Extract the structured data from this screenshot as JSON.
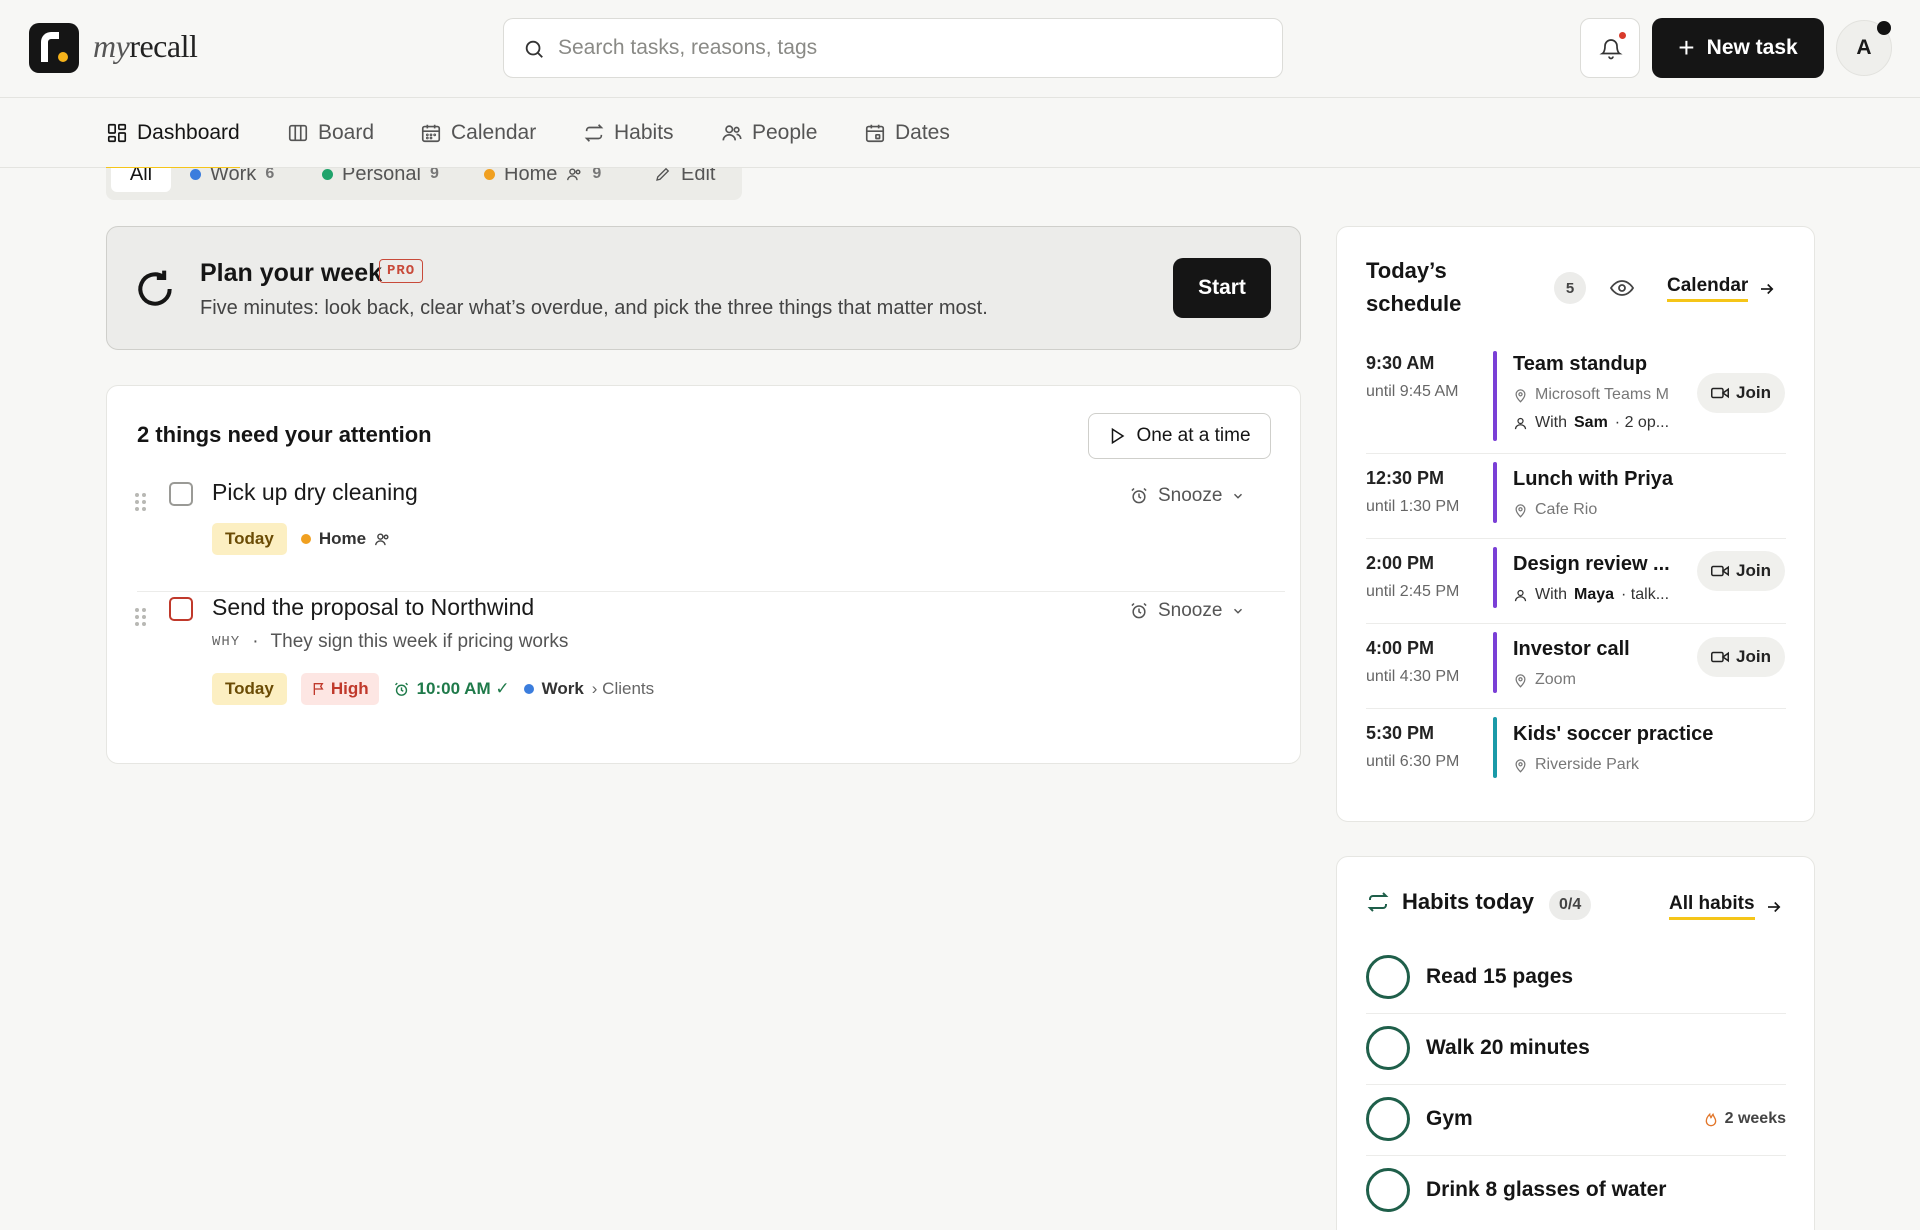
{
  "app": {
    "brand_prefix": "my",
    "brand_suffix": "recall"
  },
  "search": {
    "placeholder": "Search tasks, reasons, tags",
    "value": ""
  },
  "header": {
    "new_task_label": "New task",
    "avatar_initial": "A"
  },
  "nav": [
    {
      "label": "Dashboard",
      "icon": "dashboard-icon",
      "active": true
    },
    {
      "label": "Board",
      "icon": "board-icon"
    },
    {
      "label": "Calendar",
      "icon": "calendar-icon"
    },
    {
      "label": "Habits",
      "icon": "repeat-icon"
    },
    {
      "label": "People",
      "icon": "people-icon"
    },
    {
      "label": "Dates",
      "icon": "dates-icon"
    }
  ],
  "filters": {
    "all": "All",
    "work": {
      "label": "Work",
      "count": "6",
      "color": "#3b7ddd"
    },
    "personal": {
      "label": "Personal",
      "count": "9",
      "color": "#1fa36b"
    },
    "home": {
      "label": "Home",
      "count": "9",
      "color": "#f0a020"
    },
    "edit": "Edit"
  },
  "plan": {
    "title": "Plan your week",
    "badge": "PRO",
    "subtitle": "Five minutes: look back, clear what’s overdue, and pick the three things that matter most.",
    "button": "Start"
  },
  "attention": {
    "title": "2 things need your attention",
    "one_at_a_time": "One at a time",
    "tasks": [
      {
        "title": "Pick up dry cleaning",
        "snooze": "Snooze",
        "today": "Today",
        "list": "Home",
        "list_color": "#f0a020"
      },
      {
        "title": "Send the proposal to Northwind",
        "snooze": "Snooze",
        "why_label": "WHY",
        "why_sep": "·",
        "why": "They sign this week if pricing works",
        "today": "Today",
        "priority": "High",
        "reminder": "10:00 AM ✓",
        "list": "Work",
        "list_sub": "› Clients",
        "list_color": "#3b7ddd"
      }
    ]
  },
  "schedule": {
    "title": "Today’s schedule",
    "count": "5",
    "calendar_link": "Calendar",
    "join_label": "Join",
    "events": [
      {
        "time": "9:30 AM",
        "until": "until 9:45 AM",
        "title": "Team standup",
        "location": "Microsoft Teams M",
        "with_prefix": "With",
        "with_name": "Sam",
        "with_suffix": "· 2 op...",
        "bar": "#7a3fd6",
        "join": true
      },
      {
        "time": "12:30 PM",
        "until": "until 1:30 PM",
        "title": "Lunch with Priya",
        "location": "Cafe Rio",
        "bar": "#7a3fd6",
        "join": false
      },
      {
        "time": "2:00 PM",
        "until": "until 2:45 PM",
        "title": "Design review ...",
        "with_prefix": "With",
        "with_name": "Maya",
        "with_suffix": "· talk...",
        "bar": "#7a3fd6",
        "join": true
      },
      {
        "time": "4:00 PM",
        "until": "until 4:30 PM",
        "title": "Investor call",
        "location": "Zoom",
        "bar": "#7a3fd6",
        "join": true
      },
      {
        "time": "5:30 PM",
        "until": "until 6:30 PM",
        "title": "Kids' soccer practice",
        "location": "Riverside Park",
        "bar": "#1a9aa8",
        "join": false
      }
    ]
  },
  "habits": {
    "title": "Habits today",
    "count": "0/4",
    "all_link": "All habits",
    "items": [
      {
        "name": "Read 15 pages"
      },
      {
        "name": "Walk 20 minutes"
      },
      {
        "name": "Gym",
        "streak": "2 weeks"
      },
      {
        "name": "Drink 8 glasses of water"
      }
    ]
  }
}
